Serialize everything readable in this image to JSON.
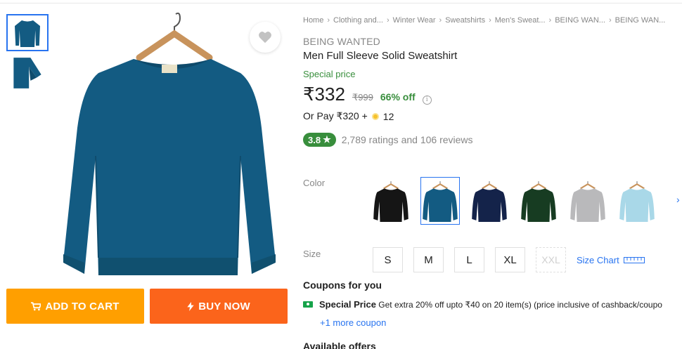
{
  "breadcrumb": [
    "Home",
    "Clothing and...",
    "Winter Wear",
    "Sweatshirts",
    "Men's Sweat...",
    "BEING WAN...",
    "BEING WAN..."
  ],
  "product": {
    "brand": "BEING WANTED",
    "title": "Men Full Sleeve Solid Sweatshirt",
    "special_price_label": "Special price",
    "price": "₹332",
    "mrp": "₹999",
    "discount": "66% off",
    "or_pay_prefix": "Or Pay ₹320 +",
    "or_pay_coins": "12",
    "rating": "3.8",
    "rating_star": "★",
    "ratings_text": "2,789 ratings and 106 reviews"
  },
  "actions": {
    "add_to_cart": "ADD TO CART",
    "buy_now": "BUY NOW"
  },
  "color_label": "Color",
  "colors": [
    {
      "name": "black",
      "hex": "#151515"
    },
    {
      "name": "teal-blue",
      "hex": "#135b82"
    },
    {
      "name": "navy",
      "hex": "#14234a"
    },
    {
      "name": "dark-green",
      "hex": "#173c22"
    },
    {
      "name": "grey",
      "hex": "#b9b9bb"
    },
    {
      "name": "sky-blue",
      "hex": "#a9d8e8"
    }
  ],
  "selected_color": "teal-blue",
  "size_label": "Size",
  "sizes": [
    "S",
    "M",
    "L",
    "XL",
    "XXL"
  ],
  "size_chart": "Size Chart",
  "coupons": {
    "heading": "Coupons for you",
    "title": "Special Price",
    "desc": "Get extra 20% off upto ₹40 on 20 item(s) (price inclusive of cashback/coupo",
    "more": "+1 more coupon"
  },
  "available_offers": "Available offers",
  "accent": "#2874f0",
  "cart_color": "#ff9f00",
  "buy_color": "#fb641b"
}
